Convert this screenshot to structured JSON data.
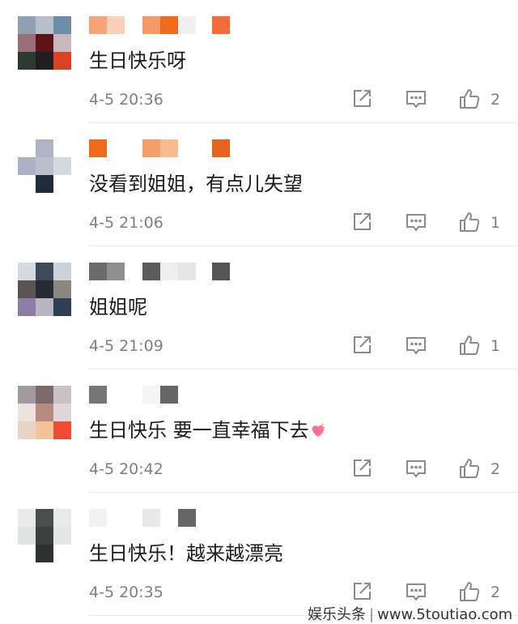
{
  "comments": [
    {
      "avatar": [
        "#8fa0b3",
        "#b6bfc9",
        "#6d8caa",
        "#9a6e78",
        "#5e1417",
        "#c7b8bd",
        "#2c3a32",
        "#1f1f1f",
        "#d84325"
      ],
      "name_blocks": [
        "#f5a47a",
        "#fbd0b6",
        "#f39a65",
        "#f06a1d",
        "#f0f0f0",
        "#f26c3b"
      ],
      "text": "生日快乐呀",
      "time": "4-5 20:36",
      "likes": "2"
    },
    {
      "avatar": [
        "#ffffff",
        "#b0b5c4",
        "#ffffff",
        "#aab2c3",
        "#b9c0cc",
        "#d4d8e0",
        "#ffffff",
        "#1f2c3d",
        "#ffffff"
      ],
      "name_blocks": [
        "#f06a1d",
        "#ffffff",
        "#f5a06a",
        "#f7b98f",
        "#ffffff",
        "#e8641c"
      ],
      "text": "没看到姐姐，有点儿失望",
      "time": "4-5 21:06",
      "likes": "1"
    },
    {
      "avatar": [
        "#d6dbe2",
        "#3e4a5b",
        "#cdd2db",
        "#5a5453",
        "#262b33",
        "#8a8680",
        "#8c7da3",
        "#b9b6c4",
        "#2e3e55"
      ],
      "name_blocks": [
        "#6b6b6b",
        "#8e8e8e",
        "#5c5c5c",
        "#eeeeee",
        "#e6e6e6",
        "#555555"
      ],
      "text": "姐姐呢",
      "time": "4-5 21:09",
      "likes": "1"
    },
    {
      "avatar": [
        "#a29aa0",
        "#7c6b69",
        "#c8c2c6",
        "#efe1dd",
        "#b88a80",
        "#e0d6da",
        "#e8d3c4",
        "#f3c39a",
        "#ef4a34"
      ],
      "name_blocks": [
        "#777777",
        "#ffffff",
        "#f5f5f5",
        "#666666",
        "#ffffff",
        "#ffffff"
      ],
      "text": "生日快乐 要一直幸福下去",
      "time": "4-5 20:42",
      "likes": "2"
    },
    {
      "avatar": [
        "#e8eaeb",
        "#4a4f4e",
        "#e8e9ea",
        "#dfe3e1",
        "#3a413e",
        "#e4e6e5",
        "#ffffff",
        "#2e3231",
        "#ffffff"
      ],
      "name_blocks": [
        "#f2f2f2",
        "#ffffff",
        "#e8e8e8",
        "#ffffff",
        "#666666",
        "#ffffff"
      ],
      "text": "生日快乐！越来越漂亮",
      "time": "4-5 20:35",
      "likes": "2"
    }
  ],
  "watermark": {
    "brand": "娱乐头条",
    "separator": "|",
    "url": "www.5toutiao.com"
  },
  "colors": {
    "text": "#1c1c1c",
    "meta": "#7f7f7f",
    "icon": "#8a8a8a",
    "divider": "#e9e9e9"
  }
}
